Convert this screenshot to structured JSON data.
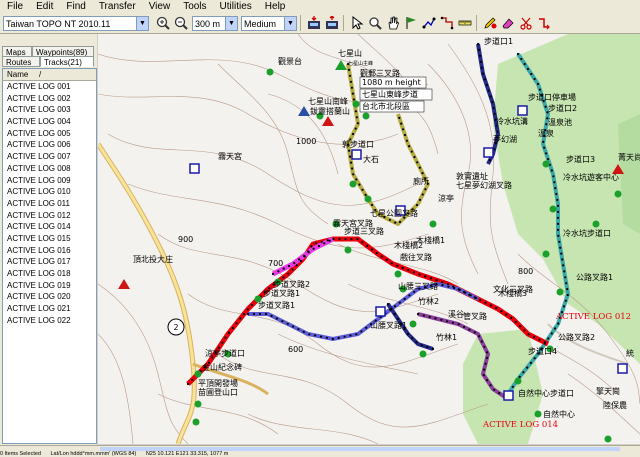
{
  "menu": [
    "File",
    "Edit",
    "Find",
    "Transfer",
    "View",
    "Tools",
    "Utilities",
    "Help"
  ],
  "toolbar": {
    "product": "Taiwan TOPO NT 2010.11",
    "zoom_scale": "300 m",
    "detail": "Medium"
  },
  "tabs": {
    "top": [
      "Maps",
      "Waypoints(89)"
    ],
    "bottom": [
      "Routes",
      "Tracks(21)"
    ]
  },
  "list": {
    "col_name": "Name",
    "col_sort": "/",
    "rows": [
      "ACTIVE LOG 001",
      "ACTIVE LOG 002",
      "ACTIVE LOG 003",
      "ACTIVE LOG 004",
      "ACTIVE LOG 005",
      "ACTIVE LOG 006",
      "ACTIVE LOG 007",
      "ACTIVE LOG 008",
      "ACTIVE LOG 009",
      "ACTIVE LOG 010",
      "ACTIVE LOG 011",
      "ACTIVE LOG 012",
      "ACTIVE LOG 014",
      "ACTIVE LOG 015",
      "ACTIVE LOG 016",
      "ACTIVE LOG 017",
      "ACTIVE LOG 018",
      "ACTIVE LOG 019",
      "ACTIVE LOG 020",
      "ACTIVE LOG 021",
      "ACTIVE LOG 022"
    ]
  },
  "map": {
    "labels": {
      "qixingshan": "七星山",
      "qixing_sub": "七星山主峰",
      "guanjingtai": "觀景台",
      "qixing_south": "七星山南峰",
      "lingsheng": "鈸靈搭蘭山",
      "guanyin_fork": "觀郵三叉路",
      "height": "1080 m height",
      "qixing_east": "七星山東峰步道",
      "taipei_high": "台北市北段區",
      "zhengbeng": "郭步道口",
      "dashi": "大石",
      "menghuan": "夢幻湖",
      "lengshuikeng_ditch": "冷水坑溝",
      "bubu_station": "步道口停車場",
      "bubu2": "步道口2",
      "lengquan": "溫泉池",
      "bubu_top": "步道口1",
      "wenquan": "溫泉",
      "bubu3": "步道口3",
      "lengshui_center": "冷水坑遊客中心",
      "qingtian": "菁天尚",
      "dubao_heritage": "敦實遺址",
      "menghuan_fork": "七星夢幻湖叉路",
      "liangting": "涼亭",
      "toilet": "廁所",
      "qixing_park_fork": "七星公園叉路",
      "bubu_3fork": "步道三叉路",
      "yutian_fork": "霧天宮叉路",
      "muzhan_bridge": "木棧橋2",
      "muzhan": "木棧橋1",
      "xitian_fork": "戲往叉路",
      "yutian": "霧天宮",
      "lengshui_bubu": "冷水坑步道口",
      "dingbei": "頂北投大庄",
      "shanzhi_fork": "山腰三叉路",
      "zhuling2": "竹林2",
      "weizhu_fork": "文化三叉路",
      "muzhan3": "木棧橋3",
      "gongluxia": "公路叉路1",
      "gongluxia2": "公路叉路2",
      "bubu_fork2": "步道叉路2",
      "bubu_fork1": "步道叉路1",
      "bubu_road1": "步道叉路1",
      "shanzhi_fork1": "山腰叉路1",
      "zhuling1": "竹林1",
      "xitian": "溪谷",
      "qiao_fork": "管叉路",
      "liangting_bubu": "涼亭步道口",
      "jinshan": "金山紀念碑",
      "pingding": "平頂開發場",
      "niuyu": "苗圃登山口",
      "bubu4": "步道口4",
      "ziran_center": "自然中心步道口",
      "ziran": "自然中心",
      "bubu_shan": "擎天崗",
      "lubao": "陸保農",
      "right_edge": "統",
      "log_012": "ACTIVE LOG 012",
      "log_014": "ACTIVE LOG 014",
      "contour_1000": "1000",
      "contour_700": "700",
      "contour_900": "900",
      "contour_800": "800",
      "contour_600": "600",
      "route_no": "2"
    },
    "colors": {
      "track_red": "#e8000b",
      "track_olive": "#b4ac3f",
      "track_navy": "#232a86",
      "track_teal": "#39a8a8",
      "track_blue": "#5c5cd8",
      "track_purple": "#8b3e9c",
      "track_magenta": "#e63ae6",
      "park_green": "#c6e5b1"
    }
  },
  "status": {
    "selected": "0 Items Selected",
    "format": "Lat/Lon hddd°mm.mmm' (WGS 84)",
    "coords": "N25 10.121 E121 33.315, 1077 m"
  }
}
